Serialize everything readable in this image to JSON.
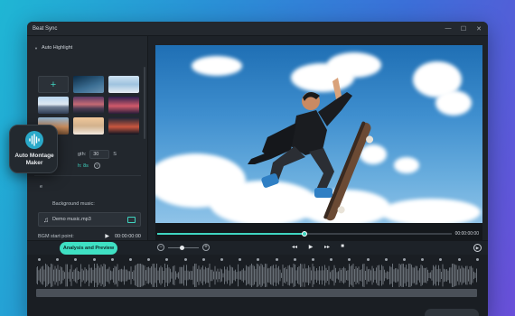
{
  "window": {
    "title": "Beat Sync"
  },
  "window_controls": {
    "minimize": "—",
    "maximize": "☐",
    "close": "✕"
  },
  "sidebar": {
    "section_title": "Auto Highlight",
    "add_symbol": "+",
    "length_label": "gth:",
    "length_value": "30",
    "length_unit": "S",
    "duration_text": "h: 8s",
    "info_symbol": "?",
    "music_section": "e",
    "background_music_label": "Background music:",
    "music_file": "Demo music.mp3",
    "bgm_start_label": "BGM start point:",
    "bgm_start_time": "00:00:00:00"
  },
  "badge": {
    "line1": "Auto Montage",
    "line2": "Maker"
  },
  "preview": {
    "current_time": "00:00:00:00",
    "progress": 0.5
  },
  "controls": {
    "analysis_button": "Analysis and Preview",
    "zoom_out_symbol": "−",
    "zoom_in_symbol": "+",
    "zoom_level": 0.45,
    "prev_symbol": "◂◂",
    "play_symbol": "▶",
    "next_symbol": "▸▸",
    "stop_symbol": "■",
    "end_play_symbol": "▶"
  },
  "colors": {
    "accent": "#3fd4c0",
    "window_bg": "#1d2228",
    "button_bg": "#3fe0c3"
  }
}
